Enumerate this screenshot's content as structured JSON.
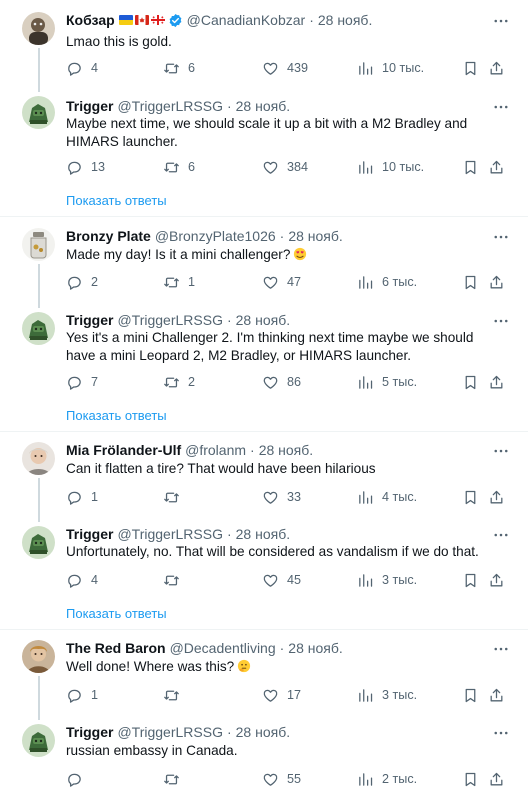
{
  "tweets": [
    {
      "name": "Кобзар",
      "handle": "@CanadianKobzar",
      "time": "28 нояб.",
      "text": "Lmao this is gold.",
      "replies": "4",
      "retweets": "6",
      "likes": "439",
      "views": "10 тыс."
    },
    {
      "name": "Trigger",
      "handle": "@TriggerLRSSG",
      "time": "28 нояб.",
      "text": "Maybe next time, we should scale it up a bit with a M2 Bradley and HIMARS launcher.",
      "replies": "13",
      "retweets": "6",
      "likes": "384",
      "views": "10 тыс."
    },
    {
      "name": "Bronzy Plate",
      "handle": "@BronzyPlate1026",
      "time": "28 нояб.",
      "text": "Made my day! Is it a mini challenger?",
      "replies": "2",
      "retweets": "1",
      "likes": "47",
      "views": "6 тыс."
    },
    {
      "name": "Trigger",
      "handle": "@TriggerLRSSG",
      "time": "28 нояб.",
      "text": "Yes it's a mini Challenger 2. I'm thinking next time maybe we should have a mini Leopard 2, M2 Bradley, or HIMARS launcher.",
      "replies": "7",
      "retweets": "2",
      "likes": "86",
      "views": "5 тыс."
    },
    {
      "name": "Mia Frölander-Ulf",
      "handle": "@frolanm",
      "time": "28 нояб.",
      "text": "Can it flatten a tire? That would have been hilarious",
      "replies": "1",
      "retweets": "",
      "likes": "33",
      "views": "4 тыс."
    },
    {
      "name": "Trigger",
      "handle": "@TriggerLRSSG",
      "time": "28 нояб.",
      "text": "Unfortunately, no. That will be considered as vandalism if we do that.",
      "replies": "4",
      "retweets": "",
      "likes": "45",
      "views": "3 тыс."
    },
    {
      "name": "The Red Baron",
      "handle": "@Decadentliving",
      "time": "28 нояб.",
      "text": "Well done! Where was this?",
      "replies": "1",
      "retweets": "",
      "likes": "17",
      "views": "3 тыс."
    },
    {
      "name": "Trigger",
      "handle": "@TriggerLRSSG",
      "time": "28 нояб.",
      "text": "russian embassy in Canada.",
      "replies": "",
      "retweets": "",
      "likes": "55",
      "views": "2 тыс."
    }
  ],
  "show_replies_label": "Показать ответы",
  "colors": {
    "link": "#1d9bf0",
    "muted": "#536471",
    "verified": "#1d9bf0"
  },
  "icons": [
    "reply-icon",
    "retweet-icon",
    "like-icon",
    "views-icon",
    "bookmark-icon",
    "share-icon",
    "more-icon",
    "verified-badge-icon"
  ]
}
